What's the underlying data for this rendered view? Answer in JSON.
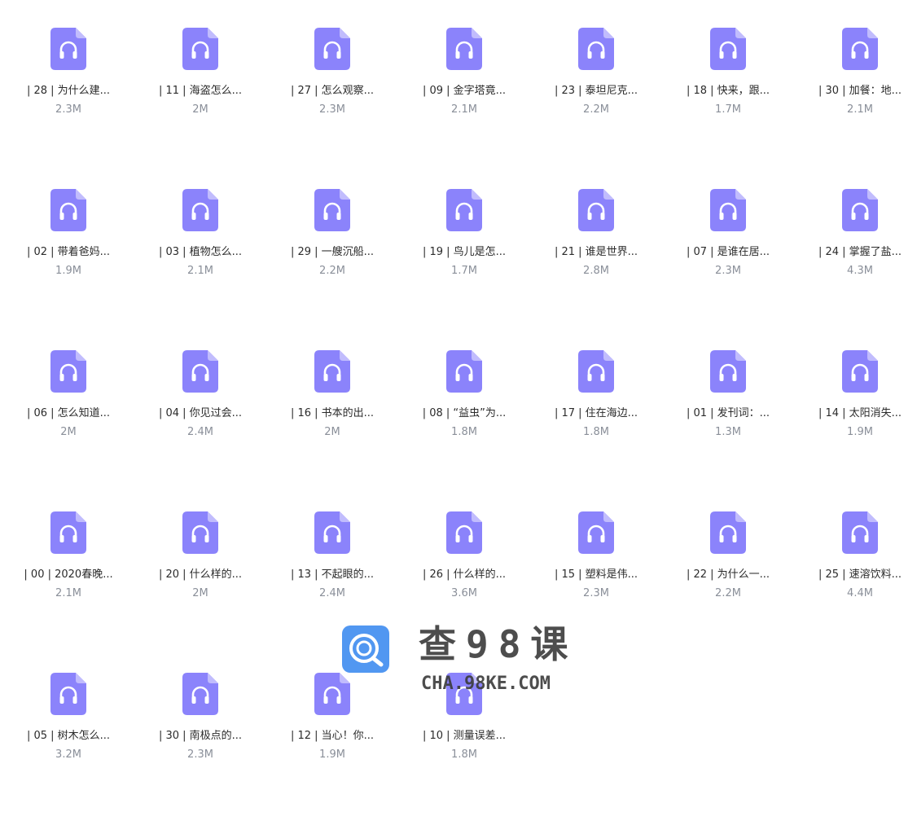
{
  "files": [
    {
      "name": "| 28 |  为什么建...",
      "size": "2.3M"
    },
    {
      "name": "| 11 |  海盗怎么...",
      "size": "2M"
    },
    {
      "name": "| 27 | 怎么观察...",
      "size": "2.3M"
    },
    {
      "name": "| 09 |  金字塔竟...",
      "size": "2.1M"
    },
    {
      "name": "| 23 |  泰坦尼克...",
      "size": "2.2M"
    },
    {
      "name": "| 18 |  快来，跟...",
      "size": "1.7M"
    },
    {
      "name": "| 30 | 加餐：地...",
      "size": "2.1M"
    },
    {
      "name": "| 02 | 带着爸妈...",
      "size": "1.9M"
    },
    {
      "name": "| 03 | 植物怎么...",
      "size": "2.1M"
    },
    {
      "name": "| 29 |  一艘沉船...",
      "size": "2.2M"
    },
    {
      "name": "| 19 |  鸟儿是怎...",
      "size": "1.7M"
    },
    {
      "name": "| 21 |  谁是世界...",
      "size": "2.8M"
    },
    {
      "name": "| 07 |  是谁在居...",
      "size": "2.3M"
    },
    {
      "name": "| 24 |  掌握了盐...",
      "size": "4.3M"
    },
    {
      "name": "| 06 |  怎么知道...",
      "size": "2M"
    },
    {
      "name": "| 04 |  你见过会...",
      "size": "2.4M"
    },
    {
      "name": "| 16 |  书本的出...",
      "size": "2M"
    },
    {
      "name": "| 08 | “益虫”为...",
      "size": "1.8M"
    },
    {
      "name": "| 17 |  住在海边...",
      "size": "1.8M"
    },
    {
      "name": "| 01 | 发刊词：...",
      "size": "1.3M"
    },
    {
      "name": "| 14 |  太阳消失...",
      "size": "1.9M"
    },
    {
      "name": "| 00 | 2020春晚...",
      "size": "2.1M"
    },
    {
      "name": "| 20 | 什么样的...",
      "size": "2M"
    },
    {
      "name": "| 13 |  不起眼的...",
      "size": "2.4M"
    },
    {
      "name": "| 26 |  什么样的...",
      "size": "3.6M"
    },
    {
      "name": "| 15 |  塑料是伟...",
      "size": "2.3M"
    },
    {
      "name": "| 22 |  为什么一...",
      "size": "2.2M"
    },
    {
      "name": "| 25 |  速溶饮料...",
      "size": "4.4M"
    },
    {
      "name": "| 05 |  树木怎么...",
      "size": "3.2M"
    },
    {
      "name": "| 30 |  南极点的...",
      "size": "2.3M"
    },
    {
      "name": "| 12 |  当心！你...",
      "size": "1.9M"
    },
    {
      "name": "| 10 |  测量误差...",
      "size": "1.8M"
    }
  ],
  "icon": {
    "name": "audio-file-icon",
    "color": "#8b83fb",
    "fold_color": "#c1bcfd"
  },
  "watermark": {
    "title": "查98课",
    "url": "CHA.98KE.COM",
    "logo_color": "#3f8cf0"
  }
}
